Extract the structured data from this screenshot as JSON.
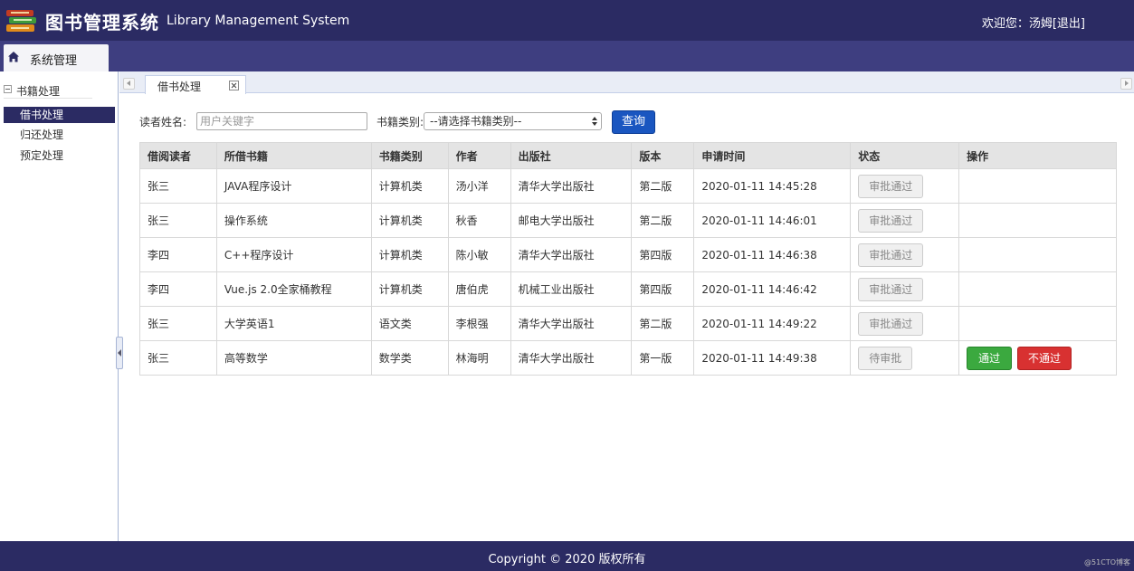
{
  "header": {
    "title_cn": "图书管理系统",
    "title_en": "Library Management System",
    "welcome": "欢迎您：汤姆",
    "logout": "[退出]"
  },
  "nav": {
    "tab_label": "系统管理",
    "icon": "home-icon"
  },
  "sidebar": {
    "section_label": "书籍处理",
    "items": [
      {
        "label": "借书处理",
        "active": true
      },
      {
        "label": "归还处理",
        "active": false
      },
      {
        "label": "预定处理",
        "active": false
      }
    ]
  },
  "tabs": {
    "active_label": "借书处理"
  },
  "search": {
    "reader_label": "读者姓名:",
    "reader_placeholder": "用户关键字",
    "category_label": "书籍类别:",
    "category_value": "--请选择书籍类别--",
    "query_button": "查询"
  },
  "table": {
    "headers": [
      "借阅读者",
      "所借书籍",
      "书籍类别",
      "作者",
      "出版社",
      "版本",
      "申请时间",
      "状态",
      "操作"
    ],
    "rows": [
      {
        "reader": "张三",
        "book": "JAVA程序设计",
        "category": "计算机类",
        "author": "汤小洋",
        "publisher": "清华大学出版社",
        "edition": "第二版",
        "time": "2020-01-11 14:45:28",
        "status": "审批通过"
      },
      {
        "reader": "张三",
        "book": "操作系统",
        "category": "计算机类",
        "author": "秋香",
        "publisher": "邮电大学出版社",
        "edition": "第二版",
        "time": "2020-01-11 14:46:01",
        "status": "审批通过"
      },
      {
        "reader": "李四",
        "book": "C++程序设计",
        "category": "计算机类",
        "author": "陈小敏",
        "publisher": "清华大学出版社",
        "edition": "第四版",
        "time": "2020-01-11 14:46:38",
        "status": "审批通过"
      },
      {
        "reader": "李四",
        "book": "Vue.js 2.0全家桶教程",
        "category": "计算机类",
        "author": "唐伯虎",
        "publisher": "机械工业出版社",
        "edition": "第四版",
        "time": "2020-01-11 14:46:42",
        "status": "审批通过"
      },
      {
        "reader": "张三",
        "book": "大学英语1",
        "category": "语文类",
        "author": "李根强",
        "publisher": "清华大学出版社",
        "edition": "第二版",
        "time": "2020-01-11 14:49:22",
        "status": "审批通过"
      },
      {
        "reader": "张三",
        "book": "高等数学",
        "category": "数学类",
        "author": "林海明",
        "publisher": "清华大学出版社",
        "edition": "第一版",
        "time": "2020-01-11 14:49:38",
        "status": "待审批",
        "approve": "通过",
        "reject": "不通过"
      }
    ]
  },
  "footer": {
    "copyright": "Copyright © 2020 版权所有",
    "watermark": "@51CTO博客"
  },
  "colors": {
    "brand": "#2b2b63",
    "primary": "#1a56c0",
    "success": "#3ba93f",
    "danger": "#d83131"
  }
}
